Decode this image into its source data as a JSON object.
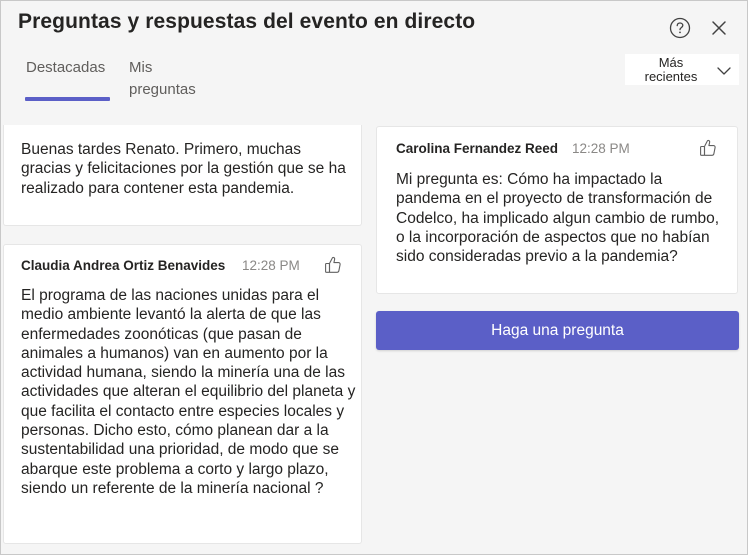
{
  "header": {
    "title": "Preguntas y respuestas del evento en directo",
    "help_icon": "question-circle-icon",
    "close_icon": "close-icon"
  },
  "tabs": [
    {
      "label": "Destacadas",
      "active": true
    },
    {
      "label": "Mis preguntas",
      "active": false
    }
  ],
  "sort": {
    "label": "Más recientes",
    "icon": "chevron-down-icon"
  },
  "colors": {
    "accent": "#5b5fc7",
    "muted_text": "#8a8886"
  },
  "questions": [
    {
      "author": "",
      "time": "",
      "text": "Buenas tardes Renato. Primero, muchas gracias y felicitaciones por la gestión que se ha realizado para contener esta pandemia."
    },
    {
      "author": "Claudia Andrea Ortiz Benavides",
      "time": "12:28 PM",
      "text": "El programa de las naciones unidas para el medio ambiente levantó la alerta de que las enfermedades zoonóticas (que pasan de animales a humanos) van en aumento por la actividad humana, siendo la minería una de las actividades que alteran el equilibrio del planeta y que facilita el contacto entre especies locales y personas. Dicho esto, cómo planean dar a la sustentabilidad una prioridad, de modo que se abarque este problema a corto y largo plazo, siendo un referente de la minería nacional ?"
    },
    {
      "author": "Carolina Fernandez Reed",
      "time": "12:28 PM",
      "text": "Mi pregunta es: Cómo ha impactado la pandema en el proyecto de transformación de Codelco, ha implicado algun cambio de rumbo, o la incorporación de aspectos que no habían sido consideradas previo a la pandemia?"
    }
  ],
  "ask_button": {
    "label": "Haga una pregunta"
  }
}
